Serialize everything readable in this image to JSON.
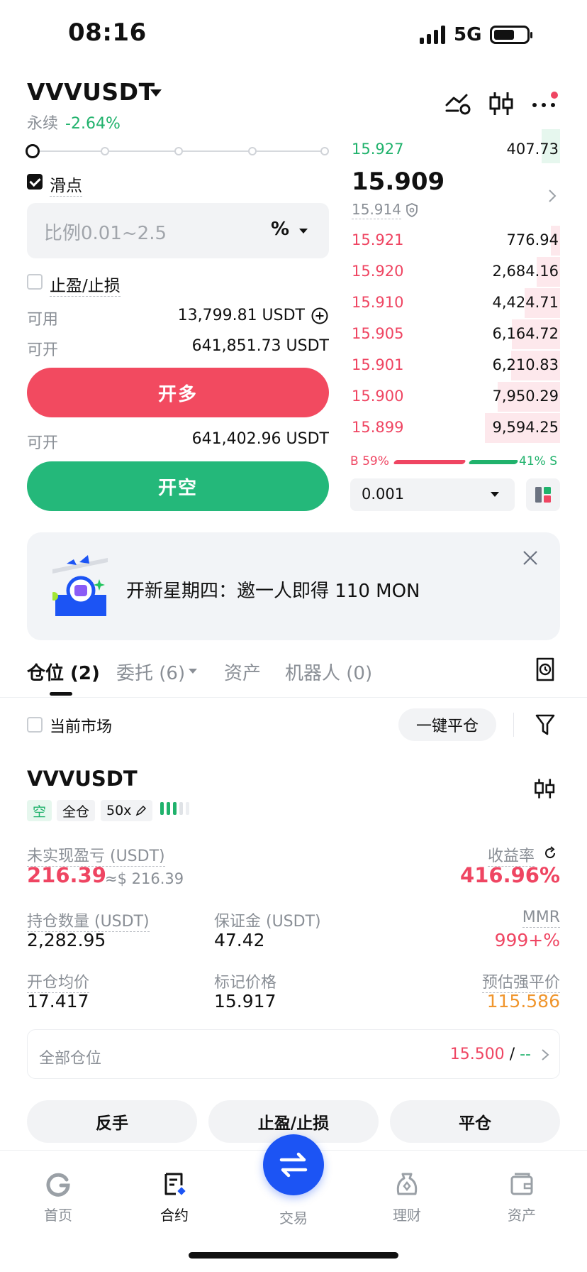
{
  "status_bar": {
    "time": "08:16",
    "network": "5G"
  },
  "header": {
    "symbol": "VVVUSDT",
    "contract_type": "永续",
    "change": "-2.64%"
  },
  "order_form": {
    "slippage_label": "滑点",
    "ratio_placeholder": "比例0.01~2.5",
    "ratio_unit": "%",
    "tpsl_label": "止盈/止损",
    "available_label": "可用",
    "available_value": "13,799.81 USDT",
    "open_long_label": "可开",
    "open_long_value": "641,851.73 USDT",
    "open_long_button": "开多",
    "open_short_label": "可开",
    "open_short_value": "641,402.96 USDT",
    "open_short_button": "开空"
  },
  "order_book": {
    "bid_top": {
      "price": "15.927",
      "amount": "407.73"
    },
    "last_price": "15.909",
    "mark_price": "15.914",
    "asks": [
      {
        "price": "15.921",
        "amount": "776.94",
        "depth": 0.12
      },
      {
        "price": "15.920",
        "amount": "2,684.16",
        "depth": 0.3
      },
      {
        "price": "15.910",
        "amount": "4,424.71",
        "depth": 0.45
      },
      {
        "price": "15.905",
        "amount": "6,164.72",
        "depth": 0.62
      },
      {
        "price": "15.901",
        "amount": "6,210.83",
        "depth": 0.63
      },
      {
        "price": "15.900",
        "amount": "7,950.29",
        "depth": 0.8
      },
      {
        "price": "15.899",
        "amount": "9,594.25",
        "depth": 0.96
      }
    ],
    "buy_ratio": "B 59%",
    "sell_ratio": "41% S",
    "buy_fraction": 0.59,
    "precision": "0.001"
  },
  "banner": {
    "text": "开新星期四：邀一人即得 110 MON"
  },
  "tabs": [
    {
      "label": "仓位 (2)"
    },
    {
      "label": "委托 (6)"
    },
    {
      "label": "资产"
    },
    {
      "label": "机器人 (0)"
    }
  ],
  "filter": {
    "current_market": "当前市场",
    "close_all": "一键平仓"
  },
  "position": {
    "symbol": "VVVUSDT",
    "side": "空",
    "margin_mode": "全仓",
    "leverage": "50x",
    "unrealized_pnl_label": "未实现盈亏 (USDT)",
    "unrealized_pnl": "216.39",
    "unrealized_pnl_usd": "≈$ 216.39",
    "roe_label": "收益率",
    "roe": "416.96%",
    "size_label": "持仓数量 (USDT)",
    "size": "2,282.95",
    "margin_label": "保证金 (USDT)",
    "margin": "47.42",
    "mmr_label": "MMR",
    "mmr": "999+%",
    "entry_label": "开仓均价",
    "entry": "17.417",
    "mark_label": "标记价格",
    "mark": "15.917",
    "liq_label": "预估强平价",
    "liq": "115.586",
    "all_positions_label": "全部仓位",
    "all_positions_tp": "15.500",
    "all_positions_sep": "/",
    "all_positions_sl": "--"
  },
  "actions": {
    "reverse": "反手",
    "tpsl": "止盈/止损",
    "close": "平仓"
  },
  "bottom_nav": [
    {
      "label": "首页"
    },
    {
      "label": "合约"
    },
    {
      "label": "交易"
    },
    {
      "label": "理财"
    },
    {
      "label": "资产"
    }
  ],
  "colors": {
    "green": "#20b26c",
    "red": "#ef4562",
    "blue": "#1c54f4",
    "orange": "#f0962e"
  }
}
